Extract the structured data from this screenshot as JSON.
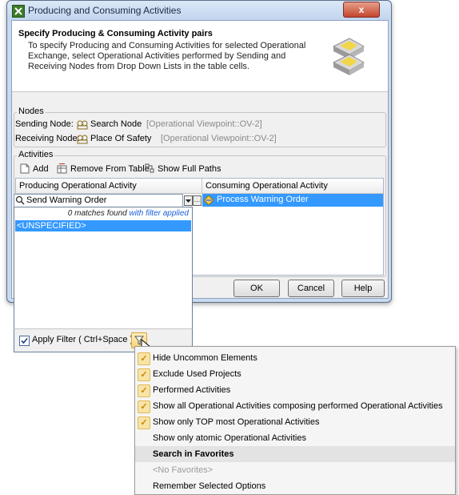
{
  "window": {
    "title": "Producing and Consuming Activities",
    "close_label": "x"
  },
  "header": {
    "title": "Specify Producing & Consuming Activity pairs",
    "description": "To specify Producing and Consuming Activities for selected Operational Exchange, select Operational Activities performed by Sending and Receiving Nodes from Drop Down Lists in the table cells."
  },
  "nodes": {
    "group_label": "Nodes",
    "sending_label": "Sending Node:",
    "sending_name": "Search Node",
    "sending_path": "[Operational Viewpoint::OV-2]",
    "receiving_label": "Receiving Node:",
    "receiving_name": "Place Of Safety",
    "receiving_path": "[Operational Viewpoint::OV-2]"
  },
  "activities": {
    "group_label": "Activities",
    "toolbar": {
      "add": "Add",
      "remove": "Remove From Table",
      "show_paths": "Show Full Paths"
    },
    "columns": [
      "Producing Operational Activity",
      "Consuming Operational Activity"
    ],
    "row": {
      "producing": "Send Warning Order",
      "consuming": "Process Warning Order"
    }
  },
  "dropdown": {
    "search_value": "Send Warning Order",
    "status_prefix": "0 matches found",
    "status_suffix": "with filter applied",
    "items": [
      "<UNSPECIFIED>"
    ],
    "apply_filter_label": "Apply Filter ( Ctrl+Space )",
    "apply_filter_checked": true
  },
  "buttons": {
    "ok": "OK",
    "cancel": "Cancel",
    "help": "Help"
  },
  "filter_menu": {
    "items": [
      {
        "label": "Hide Uncommon Elements",
        "checked": true
      },
      {
        "label": "Exclude Used Projects",
        "checked": true
      },
      {
        "label": "Performed Activities",
        "checked": true
      },
      {
        "label": "Show all Operational Activities composing performed Operational Activities",
        "checked": true
      },
      {
        "label": "Show only TOP most Operational Activities",
        "checked": true
      },
      {
        "label": "Show only atomic Operational Activities",
        "checked": false
      },
      {
        "label": "Search in Favorites",
        "checked": false,
        "bold": true
      },
      {
        "label": "<No Favorites>",
        "checked": false,
        "disabled": true
      },
      {
        "label": "Remember Selected Options",
        "checked": false
      }
    ]
  },
  "colors": {
    "selection": "#3399ff",
    "filter_link": "#1a5fd6",
    "path_gray": "#8a8a8a"
  }
}
